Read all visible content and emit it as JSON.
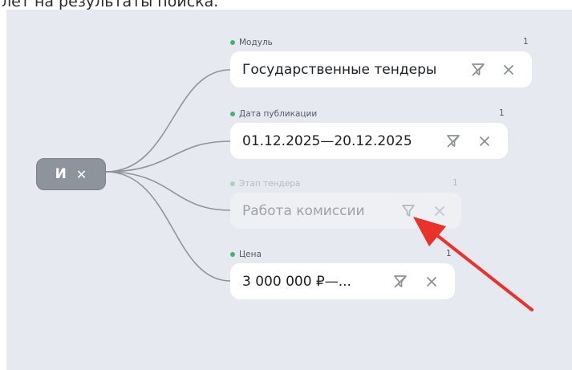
{
  "caption": "лет на результаты поиска.",
  "root": {
    "label": "И",
    "close_icon": "close-icon"
  },
  "filters": [
    {
      "title": "Модуль",
      "count": "1",
      "value": "Государственные тендеры",
      "state": "active",
      "filter_icon": "filter-off-icon",
      "remove_icon": "close-icon"
    },
    {
      "title": "Дата публикации",
      "count": "1",
      "value": "01.12.2025—20.12.2025",
      "state": "active",
      "filter_icon": "filter-off-icon",
      "remove_icon": "close-icon"
    },
    {
      "title": "Этап тендера",
      "count": "1",
      "value": "Работа комиссии",
      "state": "disabled",
      "filter_icon": "filter-icon",
      "remove_icon": "close-icon"
    },
    {
      "title": "Цена",
      "count": "1",
      "value": "3 000 000 ₽—...",
      "state": "active",
      "filter_icon": "filter-off-icon",
      "remove_icon": "close-icon"
    }
  ],
  "colors": {
    "canvas": "#e6e9ef",
    "root_node": "#8e949c",
    "dot_active": "#3eb868",
    "annotation_arrow": "#e8322a"
  }
}
